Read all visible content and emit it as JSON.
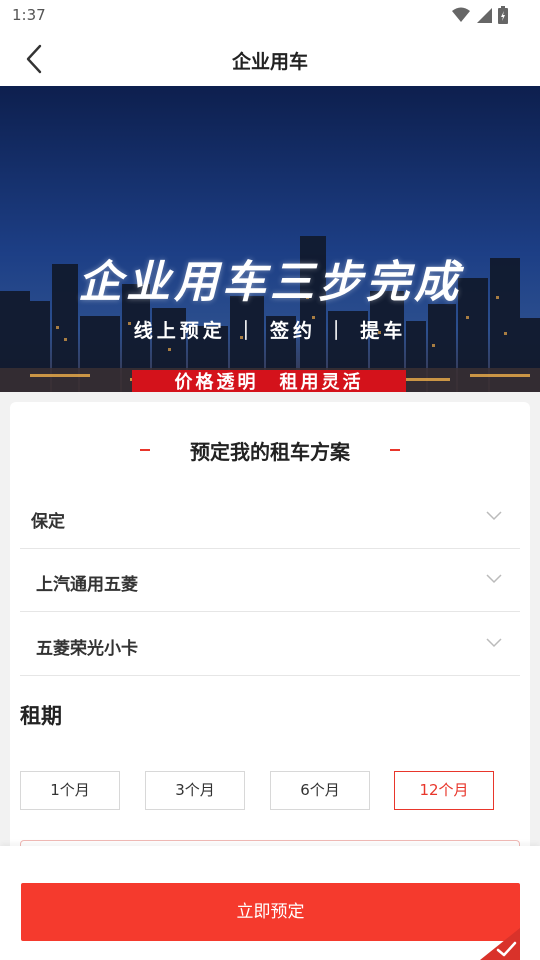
{
  "status_bar": {
    "time": "1:37"
  },
  "nav": {
    "title": "企业用车"
  },
  "banner": {
    "title": "企业用车三步完成",
    "steps": "线上预定 ｜ 签约 ｜ 提车",
    "tagline": "价格透明　租用灵活"
  },
  "form": {
    "section_title": "预定我的租车方案",
    "selects": [
      {
        "value": "保定"
      },
      {
        "value": "上汽通用五菱"
      },
      {
        "value": "五菱荣光小卡"
      }
    ],
    "lease_label": "租期",
    "periods": [
      {
        "label": "1个月",
        "selected": false
      },
      {
        "label": "3个月",
        "selected": false
      },
      {
        "label": "6个月",
        "selected": false
      },
      {
        "label": "12个月",
        "selected": true
      }
    ]
  },
  "actions": {
    "book_label": "立即预定"
  },
  "colors": {
    "accent": "#f53a2d",
    "active_border": "#e8362b",
    "dot": "#1e7bff"
  }
}
